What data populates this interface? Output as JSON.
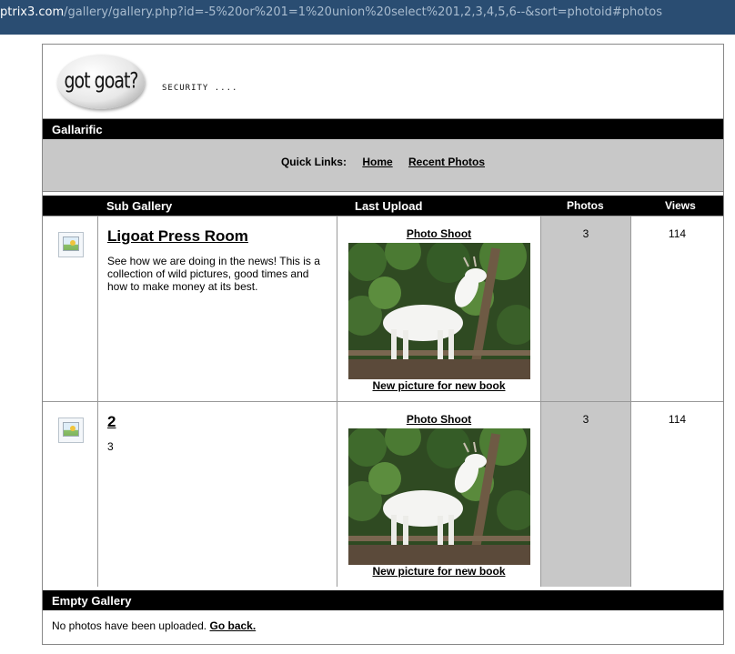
{
  "browser": {
    "url_host": "ptrix3.com",
    "url_path": "/gallery/gallery.php?id=-5%20or%201=1%20union%20select%201,2,3,4,5,6--&sort=photoid#photos"
  },
  "header": {
    "logo_text": "got goat?",
    "tagline": "SECURITY ...."
  },
  "site_title": "Gallarific",
  "quick_links": {
    "label": "Quick Links:",
    "home": "Home",
    "recent": "Recent Photos"
  },
  "columns": {
    "sub_gallery": "Sub Gallery",
    "last_upload": "Last Upload",
    "photos": "Photos",
    "views": "Views"
  },
  "galleries": [
    {
      "title": "Ligoat Press Room",
      "description": "See how we are doing in the news! This is a collection of wild pictures, good times and how to make money at its best.",
      "last_upload_album": "Photo Shoot",
      "last_upload_caption": "New picture for new book",
      "photos": "3",
      "views": "114"
    },
    {
      "title": "2",
      "description": "3",
      "last_upload_album": "Photo Shoot",
      "last_upload_caption": "New picture for new book",
      "photos": "3",
      "views": "114"
    }
  ],
  "empty_gallery": {
    "heading": "Empty Gallery",
    "message": "No photos have been uploaded.",
    "back_link": "Go back."
  },
  "icons": {
    "gallery_icon": "gallery-folder-icon",
    "thumbnail": "goat-photo-thumbnail"
  },
  "colors": {
    "url_bar": "#2a4d72",
    "header_bar": "#000000",
    "grey_panel": "#c8c8c8"
  }
}
